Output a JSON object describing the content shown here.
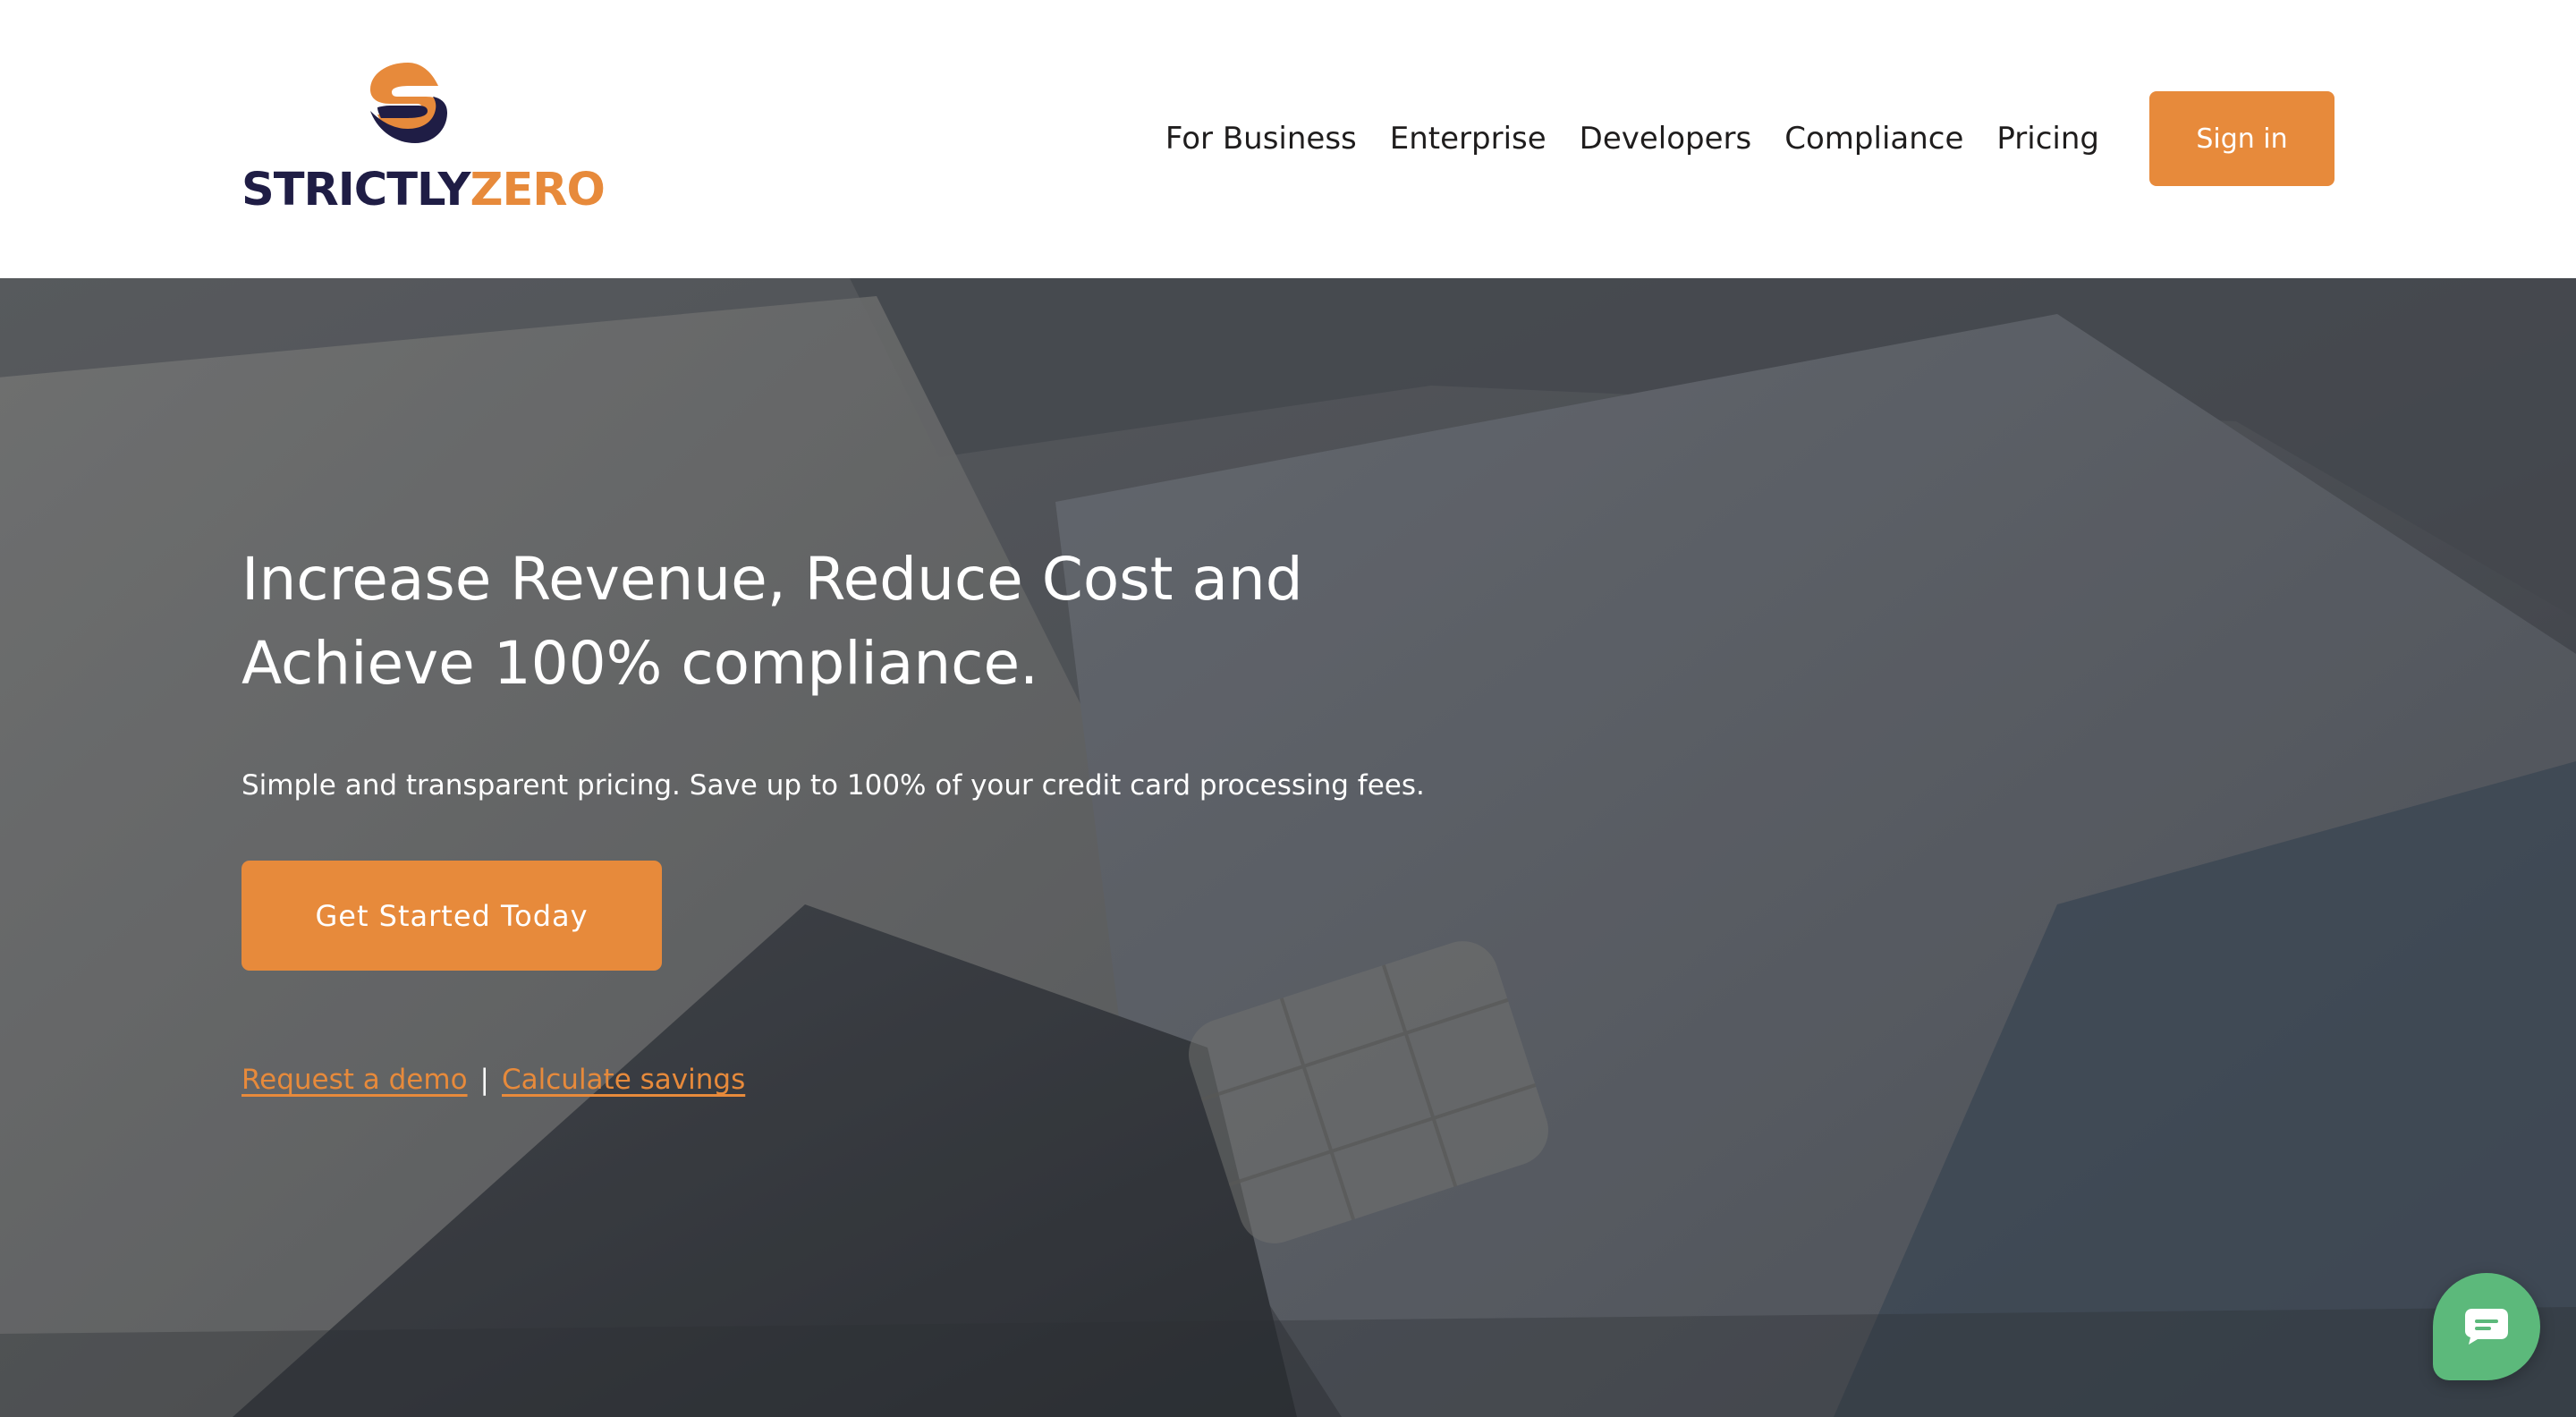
{
  "brand": {
    "name_part1": "STRICTLY",
    "name_part2": "ZERO",
    "primary_color": "#1f1d45",
    "accent_color": "#e78a3b",
    "logo_icon": "strictlyzero-s-logo-icon"
  },
  "nav": {
    "items": [
      {
        "label": "For Business"
      },
      {
        "label": "Enterprise"
      },
      {
        "label": "Developers"
      },
      {
        "label": "Compliance"
      },
      {
        "label": "Pricing"
      }
    ],
    "signin_label": "Sign in"
  },
  "hero": {
    "title": "Increase Revenue, Reduce Cost and Achieve 100% compliance.",
    "subtitle": "Simple and transparent pricing. Save up to 100% of your credit card processing fees.",
    "cta_label": "Get Started Today",
    "link_demo": "Request a demo",
    "link_separator": "|",
    "link_savings": "Calculate savings",
    "background_image": "credit-cards-photo"
  },
  "chat": {
    "icon": "chat-bubble-icon",
    "color": "#5cb97b"
  }
}
